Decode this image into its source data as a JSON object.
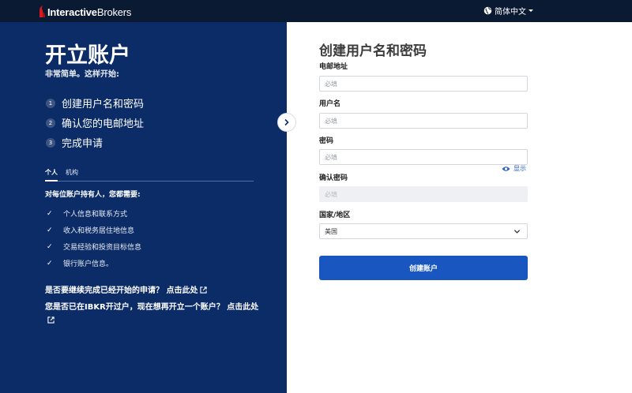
{
  "header": {
    "logo_bold": "Interactive",
    "logo_rest": "Brokers",
    "language": "简体中文",
    "globe_icon": "globe-icon",
    "brand_color": "#d71920"
  },
  "left_panel": {
    "title": "开立账户",
    "subtitle": "非常简单。这样开始:",
    "steps": [
      {
        "num": "1",
        "label": "创建用户名和密码"
      },
      {
        "num": "2",
        "label": "确认您的电邮地址"
      },
      {
        "num": "3",
        "label": "完成申请"
      }
    ],
    "tabs": [
      {
        "label": "个人",
        "active": true
      },
      {
        "label": "机构",
        "active": false
      }
    ],
    "requirements_title": "对每位账户持有人，您都需要:",
    "requirements": [
      "个人信息和联系方式",
      "收入和税务居住地信息",
      "交易经验和投资目标信息",
      "银行账户信息。"
    ],
    "continue_link": "是否要继续完成已经开始的申请？ 点击此处",
    "existing_link": "您是否已在IBKR开过户，现在想再开立一个账户？ 点击此处",
    "bg_color": "#0c2c67"
  },
  "form": {
    "title": "创建用户名和密码",
    "email_label": "电邮地址",
    "email_placeholder": "必填",
    "username_label": "用户名",
    "username_placeholder": "必填",
    "password_label": "密码",
    "password_placeholder": "必填",
    "show_label": "显示",
    "confirm_label": "确认密码",
    "confirm_placeholder": "必填",
    "country_label": "国家/地区",
    "country_value": "美国",
    "submit_label": "创建账户",
    "accent_color": "#1a56c0"
  }
}
